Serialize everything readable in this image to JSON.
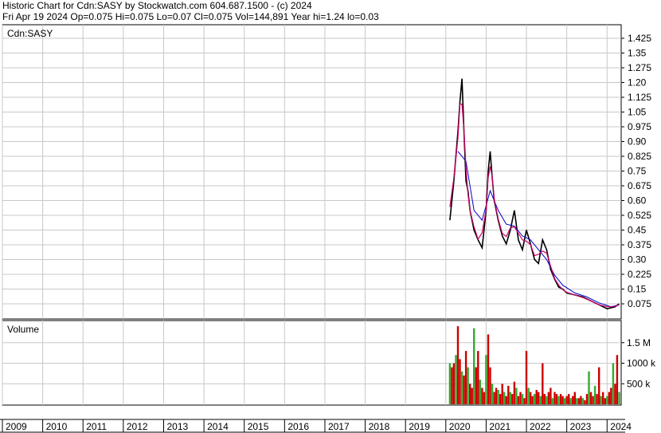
{
  "header": {
    "line1": "Historic Chart for Cdn:SASY by Stockwatch.com 604.687.1500 - (c) 2024",
    "line2": "Fri Apr 19 2024  Op=0.075  Hi=0.075  Lo=0.07  Cl=0.075  Vol=144,891  Year hi=1.24  lo=0.03"
  },
  "chart_data": [
    {
      "type": "line",
      "title": "Cdn:SASY",
      "series": [
        {
          "x": [
            "2020.1",
            "2020.2",
            "2020.3",
            "2020.35",
            "2020.4",
            "2020.45",
            "2020.5",
            "2020.55",
            "2020.6",
            "2020.7",
            "2020.8",
            "2020.9",
            "2021.0",
            "2021.05",
            "2021.1",
            "2021.15",
            "2021.2",
            "2021.3",
            "2021.4",
            "2021.5",
            "2021.6",
            "2021.7",
            "2021.8",
            "2021.9",
            "2022.0",
            "2022.1",
            "2022.2",
            "2022.3",
            "2022.4",
            "2022.5",
            "2022.6",
            "2022.7",
            "2022.8",
            "2022.9",
            "2023.0",
            "2023.2",
            "2023.4",
            "2023.6",
            "2023.8",
            "2024.0",
            "2024.2",
            "2024.3"
          ],
          "values": [
            0.5,
            0.7,
            0.95,
            1.1,
            1.22,
            0.95,
            0.7,
            0.65,
            0.55,
            0.45,
            0.4,
            0.36,
            0.55,
            0.75,
            0.85,
            0.72,
            0.6,
            0.5,
            0.42,
            0.38,
            0.45,
            0.55,
            0.4,
            0.35,
            0.45,
            0.38,
            0.3,
            0.28,
            0.4,
            0.35,
            0.25,
            0.2,
            0.16,
            0.15,
            0.13,
            0.12,
            0.11,
            0.09,
            0.07,
            0.05,
            0.06,
            0.075
          ]
        },
        {
          "x": [
            "2020.3",
            "2020.5",
            "2020.7",
            "2020.9",
            "2021.1",
            "2021.3",
            "2021.5",
            "2021.7",
            "2021.9",
            "2022.1",
            "2022.3",
            "2022.5",
            "2022.7",
            "2022.9",
            "2023.2",
            "2023.5",
            "2023.8",
            "2024.1",
            "2024.3"
          ],
          "values": [
            0.85,
            0.8,
            0.55,
            0.5,
            0.65,
            0.55,
            0.48,
            0.47,
            0.42,
            0.4,
            0.35,
            0.3,
            0.22,
            0.17,
            0.13,
            0.11,
            0.08,
            0.06,
            0.07
          ]
        }
      ],
      "ylim": [
        0,
        1.425
      ],
      "yticks": [
        "1.425",
        "1.35",
        "1.275",
        "1.20",
        "1.125",
        "1.05",
        "0.975",
        "0.90",
        "0.825",
        "0.75",
        "0.675",
        "0.60",
        "0.525",
        "0.45",
        "0.375",
        "0.30",
        "0.225",
        "0.15",
        "0.075"
      ],
      "ytick_values": [
        1.425,
        1.35,
        1.275,
        1.2,
        1.125,
        1.05,
        0.975,
        0.9,
        0.825,
        0.75,
        0.675,
        0.6,
        0.525,
        0.45,
        0.375,
        0.3,
        0.225,
        0.15,
        0.075
      ],
      "grid": true,
      "price_color": "#000000",
      "ma_short_color": "#cc0066",
      "ma_long_color": "#0000cc"
    },
    {
      "type": "bar",
      "title": "Volume",
      "x": [
        "2020.1",
        "2020.15",
        "2020.2",
        "2020.25",
        "2020.3",
        "2020.35",
        "2020.4",
        "2020.45",
        "2020.5",
        "2020.55",
        "2020.6",
        "2020.65",
        "2020.7",
        "2020.75",
        "2020.8",
        "2020.85",
        "2020.9",
        "2020.95",
        "2021.0",
        "2021.05",
        "2021.1",
        "2021.15",
        "2021.2",
        "2021.25",
        "2021.3",
        "2021.35",
        "2021.4",
        "2021.45",
        "2021.5",
        "2021.55",
        "2021.6",
        "2021.65",
        "2021.7",
        "2021.75",
        "2021.8",
        "2021.85",
        "2021.9",
        "2021.95",
        "2022.0",
        "2022.05",
        "2022.1",
        "2022.15",
        "2022.2",
        "2022.25",
        "2022.3",
        "2022.35",
        "2022.4",
        "2022.45",
        "2022.5",
        "2022.55",
        "2022.6",
        "2022.65",
        "2022.7",
        "2022.75",
        "2022.8",
        "2022.85",
        "2022.9",
        "2022.95",
        "2023.0",
        "2023.05",
        "2023.1",
        "2023.15",
        "2023.2",
        "2023.25",
        "2023.3",
        "2023.35",
        "2023.4",
        "2023.45",
        "2023.5",
        "2023.55",
        "2023.6",
        "2023.65",
        "2023.7",
        "2023.75",
        "2023.8",
        "2023.85",
        "2023.9",
        "2023.95",
        "2024.0",
        "2024.05",
        "2024.1",
        "2024.15",
        "2024.2",
        "2024.25",
        "2024.3"
      ],
      "values": [
        1000000,
        900000,
        1000000,
        1200000,
        1900000,
        1100000,
        800000,
        700000,
        1300000,
        900000,
        500000,
        400000,
        1850000,
        900000,
        1300000,
        600000,
        400000,
        300000,
        1200000,
        1700000,
        900000,
        500000,
        300000,
        400000,
        350000,
        250000,
        500000,
        300000,
        200000,
        450000,
        300000,
        250000,
        550000,
        400000,
        200000,
        300000,
        250000,
        150000,
        1300000,
        400000,
        300000,
        200000,
        250000,
        350000,
        300000,
        200000,
        1000000,
        250000,
        200000,
        300000,
        400000,
        150000,
        300000,
        250000,
        200000,
        250000,
        200000,
        150000,
        200000,
        250000,
        150000,
        200000,
        300000,
        150000,
        150000,
        200000,
        150000,
        100000,
        250000,
        800000,
        300000,
        200000,
        450000,
        250000,
        900000,
        200000,
        300000,
        150000,
        200000,
        300000,
        400000,
        1000000,
        500000,
        1200000,
        300000
      ],
      "yticks": [
        "1.5 M",
        "1000 k",
        "500 k"
      ],
      "ytick_values": [
        1500000,
        1000000,
        500000
      ],
      "ylim": [
        0,
        2000000
      ],
      "up_color": "#33aa33",
      "down_color": "#cc0000"
    }
  ],
  "xaxis": {
    "years": [
      "2009",
      "2010",
      "2011",
      "2012",
      "2013",
      "2014",
      "2015",
      "2016",
      "2017",
      "2018",
      "2019",
      "2020",
      "2021",
      "2022",
      "2023",
      "2024"
    ],
    "range": [
      2009,
      2024.35
    ]
  }
}
